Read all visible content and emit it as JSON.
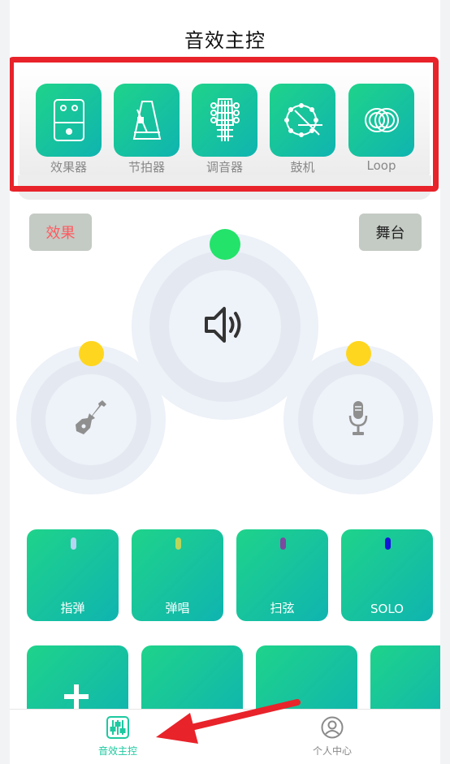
{
  "header": {
    "title": "音效主控"
  },
  "tools": [
    {
      "icon": "effect-pedal-icon",
      "label": "效果器"
    },
    {
      "icon": "metronome-icon",
      "label": "节拍器"
    },
    {
      "icon": "tuner-icon",
      "label": "调音器"
    },
    {
      "icon": "drum-icon",
      "label": "鼓机"
    },
    {
      "icon": "loop-icon",
      "label": "Loop"
    }
  ],
  "controls": {
    "effect_label": "效果",
    "stage_label": "舞台"
  },
  "dials": {
    "main_icon": "speaker-icon",
    "left_icon": "guitar-icon",
    "right_icon": "microphone-icon",
    "knob_colors": {
      "main": "#23e36b",
      "side": "#ffd61f"
    }
  },
  "modes": [
    {
      "label": "指弹",
      "led_color": "#b7d4f2"
    },
    {
      "label": "弹唱",
      "led_color": "#b9d65a"
    },
    {
      "label": "扫弦",
      "led_color": "#7c4aa0"
    },
    {
      "label": "SOLO",
      "led_color": "#1414d9"
    }
  ],
  "add_icon": "plus-icon",
  "tabbar": {
    "items": [
      {
        "icon": "mixer-icon",
        "label": "音效主控",
        "active": true
      },
      {
        "icon": "user-icon",
        "label": "个人中心",
        "active": false
      }
    ]
  },
  "colors": {
    "accent": "#1dc9a0",
    "tile_gradient_start": "#1fd38a",
    "tile_gradient_end": "#0fb4b0",
    "highlight": "#e8232a"
  }
}
